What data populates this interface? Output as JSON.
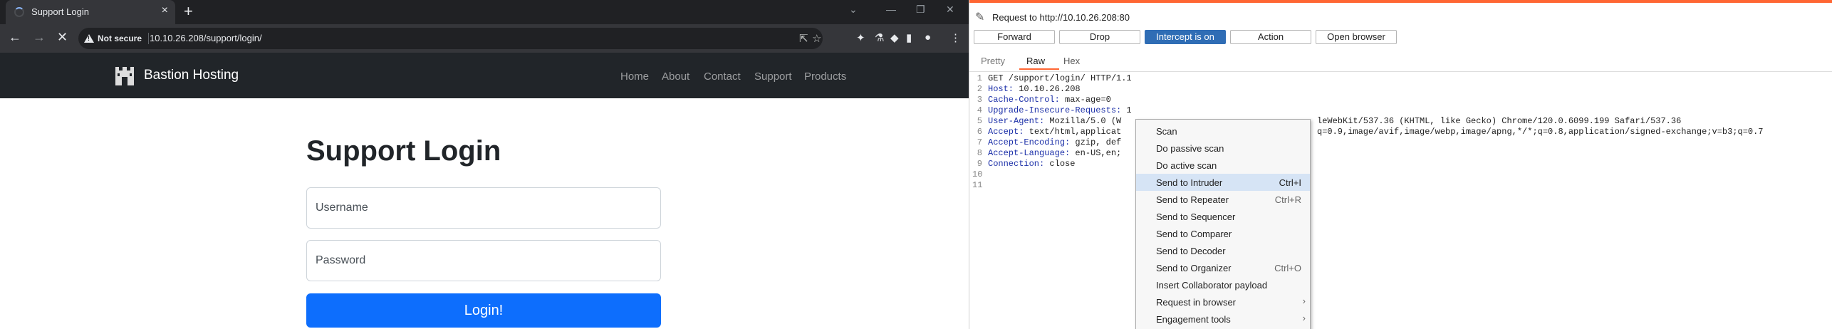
{
  "browser": {
    "tab_title": "Support Login",
    "tab_close": "×",
    "new_tab": "+",
    "not_secure": "Not secure",
    "url": "10.10.26.208/support/login/",
    "site": {
      "brand": "Bastion Hosting",
      "nav": [
        "Home",
        "About",
        "Contact",
        "Support",
        "Products"
      ]
    },
    "page": {
      "title": "Support Login",
      "username_placeholder": "Username",
      "password_placeholder": "Password",
      "login_button": "Login!"
    }
  },
  "burp": {
    "request_label": "Request to http://10.10.26.208:80",
    "buttons": [
      "Forward",
      "Drop",
      "Intercept is on",
      "Action",
      "Open browser"
    ],
    "subtabs": [
      "Pretty",
      "Raw",
      "Hex"
    ],
    "lines": [
      {
        "n": "1",
        "name": "",
        "value": "GET /support/login/ HTTP/1.1"
      },
      {
        "n": "2",
        "name": "Host:",
        "value": " 10.10.26.208"
      },
      {
        "n": "3",
        "name": "Cache-Control:",
        "value": " max-age=0"
      },
      {
        "n": "4",
        "name": "Upgrade-Insecure-Requests:",
        "value": " 1"
      },
      {
        "n": "5",
        "name": "User-Agent:",
        "value": " Mozilla/5.0 (W",
        "tail": "leWebKit/537.36 (KHTML, like Gecko) Chrome/120.0.6099.199 Safari/537.36"
      },
      {
        "n": "6",
        "name": "Accept:",
        "value": " text/html,applicat",
        "tail": "q=0.9,image/avif,image/webp,image/apng,*/*;q=0.8,application/signed-exchange;v=b3;q=0.7"
      },
      {
        "n": "7",
        "name": "Accept-Encoding:",
        "value": " gzip, def"
      },
      {
        "n": "8",
        "name": "Accept-Language:",
        "value": " en-US,en;"
      },
      {
        "n": "9",
        "name": "Connection:",
        "value": " close"
      },
      {
        "n": "10",
        "name": "",
        "value": ""
      },
      {
        "n": "11",
        "name": "",
        "value": ""
      }
    ],
    "context_menu": [
      {
        "label": "Scan",
        "shortcut": ""
      },
      {
        "label": "Do passive scan",
        "shortcut": ""
      },
      {
        "label": "Do active scan",
        "shortcut": ""
      },
      {
        "label": "Send to Intruder",
        "shortcut": "Ctrl+I"
      },
      {
        "label": "Send to Repeater",
        "shortcut": "Ctrl+R"
      },
      {
        "label": "Send to Sequencer",
        "shortcut": ""
      },
      {
        "label": "Send to Comparer",
        "shortcut": ""
      },
      {
        "label": "Send to Decoder",
        "shortcut": ""
      },
      {
        "label": "Send to Organizer",
        "shortcut": "Ctrl+O"
      },
      {
        "label": "Insert Collaborator payload",
        "shortcut": ""
      },
      {
        "label": "Request in browser",
        "shortcut": ""
      },
      {
        "label": "Engagement tools",
        "shortcut": ""
      }
    ]
  }
}
